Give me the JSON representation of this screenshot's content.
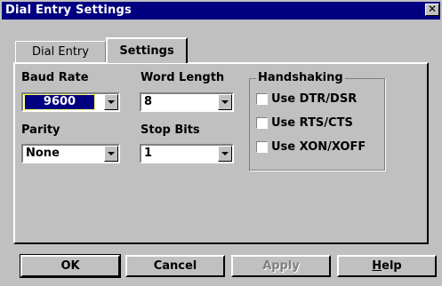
{
  "window": {
    "title": "Dial Entry Settings",
    "close_label": "✕"
  },
  "tabs": [
    {
      "label": "Dial Entry"
    },
    {
      "label": "Settings"
    }
  ],
  "baud_rate": {
    "label": "Baud Rate",
    "value": "9600"
  },
  "word_length": {
    "label": "Word Length",
    "value": "8"
  },
  "parity": {
    "label": "Parity",
    "value": "None"
  },
  "stop_bits": {
    "label": "Stop Bits",
    "value": "1"
  },
  "handshaking": {
    "title": "Handshaking",
    "options": [
      {
        "label": "Use DTR/DSR",
        "checked": false
      },
      {
        "label": "Use RTS/CTS",
        "checked": false
      },
      {
        "label": "Use XON/XOFF",
        "checked": false
      }
    ]
  },
  "buttons": {
    "ok": "OK",
    "cancel": "Cancel",
    "apply": "Apply",
    "help_prefix": "",
    "help_underlined": "H",
    "help_rest": "elp"
  }
}
